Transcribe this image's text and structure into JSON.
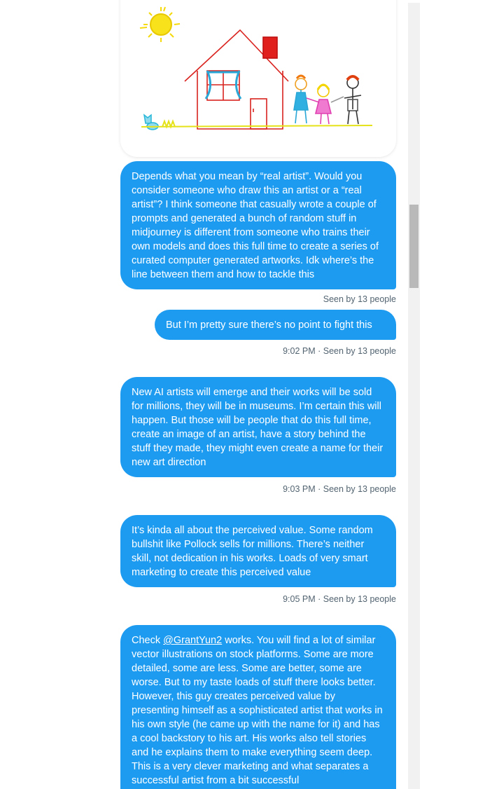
{
  "conversation": {
    "messages": [
      {
        "text": "Depends what you mean by “real artist”. Would you consider someone who draw this an artist or a “real artist”? I think someone that casually wrote a couple of prompts and generated a bunch of random stuff in midjourney is different from someone who trains their own models and does this full time to create a series of curated computer generated artworks. Idk where’s the line between them and how to tackle this",
        "meta": "Seen by 13 people"
      },
      {
        "text": "But I’m pretty sure there’s no point to fight this",
        "time": "9:02 PM",
        "meta": "Seen by 13 people"
      },
      {
        "text": "New AI artists will emerge and their works will be sold for millions, they will be in museums. I’m certain this will happen. But those will be people that do this full time, create an image of an artist, have a story behind the stuff they made, they might even create a name for their new art direction",
        "time": "9:03 PM",
        "meta": "Seen by 13 people"
      },
      {
        "text": "It’s kinda all about the perceived value. Some random bullshit like Pollock sells for millions. There’s neither skill, not dedication in his works. Loads of very smart marketing to create this perceived value",
        "time": "9:05 PM",
        "meta": "Seen by 13 people"
      },
      {
        "text_before": "Check ",
        "mention": "@GrantYun2",
        "text_after": " works. You will find a lot of similar vector illustrations on stock platforms. Some are more detailed, some are less. Some are better, some are worse. But to my taste loads of stuff there looks better. However, this guy creates perceived value by presenting himself as a sophisticated artist that works in his own style (he came up with the name for it) and has a cool backstory to his art. His works also tell stories and he explains them to make everything seem deep. This is a very clever marketing and what separates a successful artist from a bit successful"
      }
    ],
    "separator": " · "
  },
  "colors": {
    "bubble": "#1d9bf0",
    "meta_text": "#536471",
    "scrollbar_track": "#f1f1f1",
    "scrollbar_thumb": "#b9b9b9"
  }
}
